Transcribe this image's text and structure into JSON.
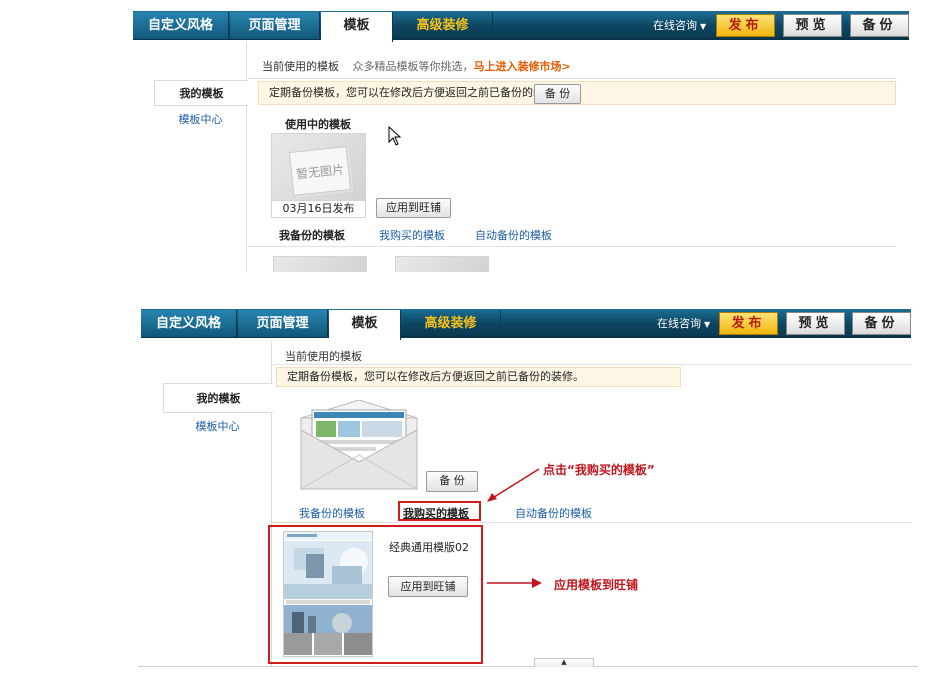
{
  "top_panel": {
    "nav": {
      "tabs": [
        "自定义风格",
        "页面管理",
        "模板",
        "高级装修"
      ],
      "online": "在线咨询",
      "publish": "发布",
      "preview": "预览",
      "backup": "备份"
    },
    "sidebar": {
      "my_templates": "我的模板",
      "template_center": "模板中心"
    },
    "current_label": "当前使用的模板",
    "market_prompt": "众多精品模板等你挑选，",
    "market_link": "马上进入装修市场>",
    "notice": "定期备份模板，您可以在修改后方便返回之前已备份的装修。",
    "notice_backup_btn": "备 份",
    "in_use_heading": "使用中的模板",
    "no_image": "暂无图片",
    "publish_date": "03月16日发布",
    "apply_btn": "应用到旺铺",
    "subtabs": [
      "我备份的模板",
      "我购买的模板",
      "自动备份的模板"
    ]
  },
  "bottom_panel": {
    "nav": {
      "tabs": [
        "自定义风格",
        "页面管理",
        "模板",
        "高级装修"
      ],
      "online": "在线咨询",
      "publish": "发布",
      "preview": "预览",
      "backup": "备份"
    },
    "sidebar": {
      "my_templates": "我的模板",
      "template_center": "模板中心"
    },
    "current_label": "当前使用的模板",
    "notice": "定期备份模板，您可以在修改后方便返回之前已备份的装修。",
    "backup_btn": "备 份",
    "subtabs": [
      "我备份的模板",
      "我购买的模板",
      "自动备份的模板"
    ],
    "template_name": "经典通用模版02",
    "apply_btn": "应用到旺铺"
  },
  "annotations": {
    "click_bought": "点击“我购买的模板”",
    "apply_template": "应用模板到旺铺"
  },
  "colors": {
    "nav_bg": "#0c4561",
    "gold_tab": "#f7c21a",
    "publish_bg": "#f1b50d",
    "link_blue": "#1c5ea8",
    "callout_red": "#c0161d"
  }
}
